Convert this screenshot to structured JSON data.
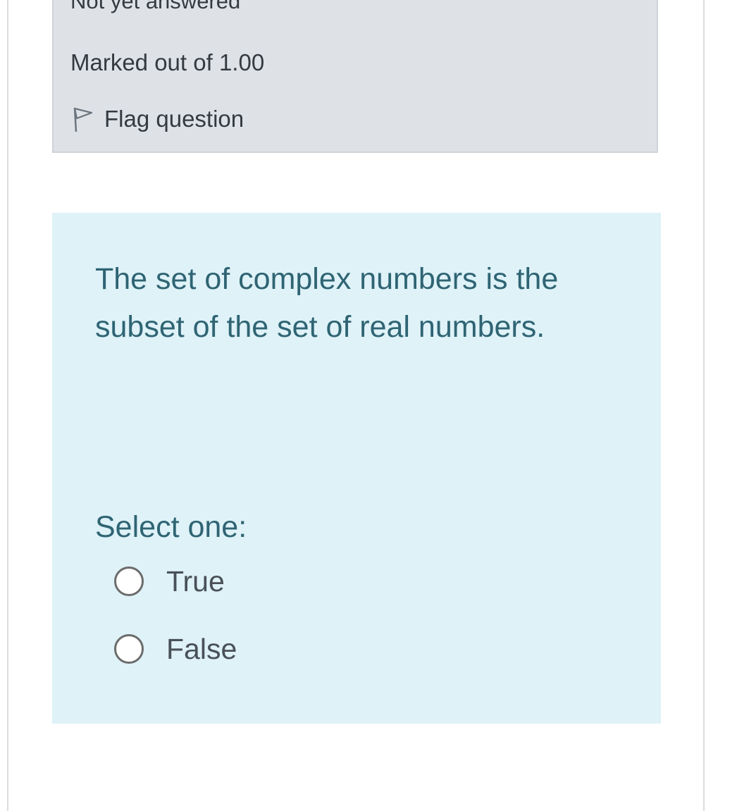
{
  "question_info": {
    "state": "Not yet answered",
    "grade": "Marked out of 1.00",
    "flag_label": "Flag question"
  },
  "question": {
    "text": "The set of complex numbers is the subset of the set of real numbers.",
    "prompt": "Select one:",
    "options": [
      {
        "label": "True",
        "selected": false
      },
      {
        "label": "False",
        "selected": false
      }
    ]
  },
  "colors": {
    "info_background": "#dee2e6",
    "question_background": "#def2f8",
    "question_text": "#2f6473"
  },
  "icons": {
    "flag": "flag-outline-icon",
    "radio": "radio-unchecked-icon"
  }
}
